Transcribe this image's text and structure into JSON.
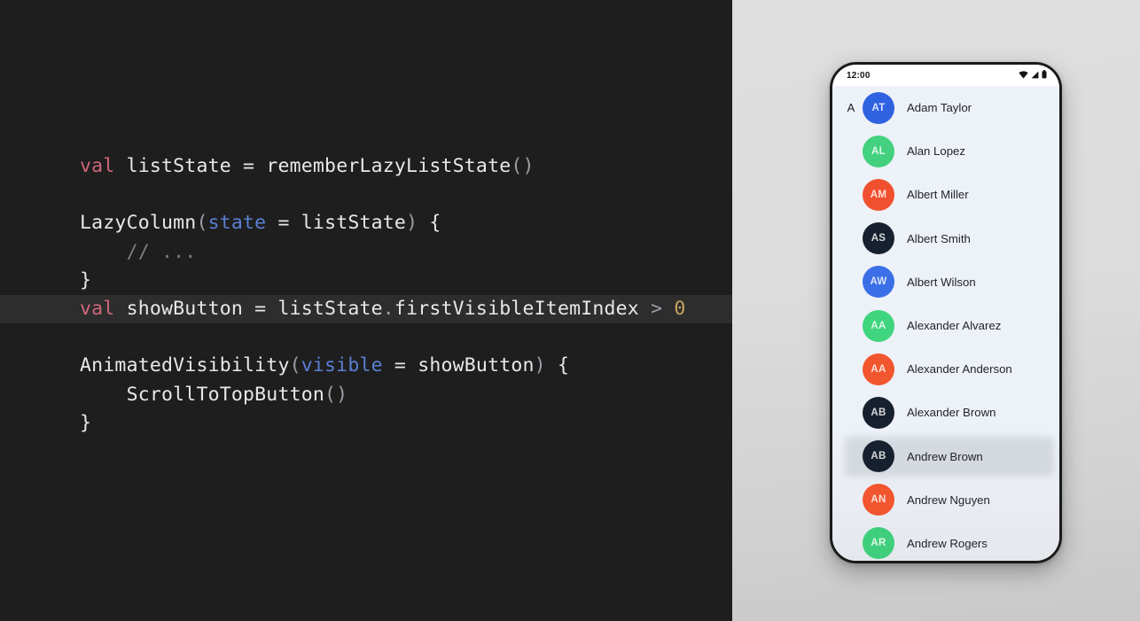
{
  "code": {
    "language": "kotlin",
    "highlighted_line_index": 5,
    "lines": [
      {
        "id": "l0",
        "tokens": [
          {
            "t": "val",
            "c": "kw"
          },
          {
            "t": " listState ",
            "c": "plain"
          },
          {
            "t": "= ",
            "c": "plain"
          },
          {
            "t": "rememberLazyListState",
            "c": "plain"
          },
          {
            "t": "()",
            "c": "punc"
          }
        ]
      },
      {
        "id": "l1",
        "tokens": [
          {
            "t": " ",
            "c": "plain"
          }
        ]
      },
      {
        "id": "l2",
        "tokens": [
          {
            "t": "LazyColumn",
            "c": "plain"
          },
          {
            "t": "(",
            "c": "punc"
          },
          {
            "t": "state",
            "c": "param"
          },
          {
            "t": " = ",
            "c": "plain"
          },
          {
            "t": "listState",
            "c": "plain"
          },
          {
            "t": ")",
            "c": "punc"
          },
          {
            "t": " {",
            "c": "plain"
          }
        ]
      },
      {
        "id": "l3",
        "tokens": [
          {
            "t": "    // ...",
            "c": "cmt"
          }
        ]
      },
      {
        "id": "l4",
        "tokens": [
          {
            "t": "}",
            "c": "plain"
          }
        ]
      },
      {
        "id": "l5",
        "tokens": [
          {
            "t": "val",
            "c": "kw"
          },
          {
            "t": " showButton ",
            "c": "plain"
          },
          {
            "t": "= ",
            "c": "plain"
          },
          {
            "t": "listState",
            "c": "plain"
          },
          {
            "t": ".",
            "c": "punc"
          },
          {
            "t": "firstVisibleItemIndex",
            "c": "plain"
          },
          {
            "t": " ",
            "c": "plain"
          },
          {
            "t": ">",
            "c": "punc"
          },
          {
            "t": " ",
            "c": "plain"
          },
          {
            "t": "0",
            "c": "num"
          }
        ]
      },
      {
        "id": "l6",
        "tokens": [
          {
            "t": " ",
            "c": "plain"
          }
        ]
      },
      {
        "id": "l7",
        "tokens": [
          {
            "t": "AnimatedVisibility",
            "c": "plain"
          },
          {
            "t": "(",
            "c": "punc"
          },
          {
            "t": "visible",
            "c": "param"
          },
          {
            "t": " = ",
            "c": "plain"
          },
          {
            "t": "showButton",
            "c": "plain"
          },
          {
            "t": ")",
            "c": "punc"
          },
          {
            "t": " {",
            "c": "plain"
          }
        ]
      },
      {
        "id": "l8",
        "tokens": [
          {
            "t": "    ScrollToTopButton",
            "c": "plain"
          },
          {
            "t": "()",
            "c": "punc"
          }
        ]
      },
      {
        "id": "l9",
        "tokens": [
          {
            "t": "}",
            "c": "plain"
          }
        ]
      }
    ],
    "colors": {
      "background": "#1e1e1e",
      "highlight_background": "#2d2d2d",
      "keyword": "#cf6679",
      "parameter": "#5b7fd4",
      "number": "#c8a45c",
      "comment": "#7d7d7d",
      "punctuation": "#9aa0a6",
      "text": "#e8e8e8"
    }
  },
  "phone": {
    "background_color": "#dcdcdc",
    "status_bar": {
      "time": "12:00",
      "icons": [
        "wifi-icon",
        "signal-icon",
        "battery-icon"
      ]
    },
    "list": {
      "section_header": "A",
      "contacts": [
        {
          "initials": "AT",
          "name": "Adam Taylor",
          "color": "#2f62e0",
          "section": "A",
          "focused": false
        },
        {
          "initials": "AL",
          "name": "Alan Lopez",
          "color": "#43d17f",
          "section": "",
          "focused": false
        },
        {
          "initials": "AM",
          "name": "Albert Miller",
          "color": "#f1502f",
          "section": "",
          "focused": false
        },
        {
          "initials": "AS",
          "name": "Albert Smith",
          "color": "#16202e",
          "section": "",
          "focused": false
        },
        {
          "initials": "AW",
          "name": "Albert Wilson",
          "color": "#3a6fe8",
          "section": "",
          "focused": false
        },
        {
          "initials": "AA",
          "name": "Alexander Alvarez",
          "color": "#3fd47e",
          "section": "",
          "focused": false
        },
        {
          "initials": "AA",
          "name": "Alexander Anderson",
          "color": "#f2562f",
          "section": "",
          "focused": false
        },
        {
          "initials": "AB",
          "name": "Alexander Brown",
          "color": "#16202e",
          "section": "",
          "focused": false
        },
        {
          "initials": "AB",
          "name": "Andrew Brown",
          "color": "#16202e",
          "section": "",
          "focused": true
        },
        {
          "initials": "AN",
          "name": "Andrew Nguyen",
          "color": "#f2562f",
          "section": "",
          "focused": false
        },
        {
          "initials": "AR",
          "name": "Andrew Rogers",
          "color": "#3fcf7c",
          "section": "",
          "focused": false
        },
        {
          "initials": "",
          "name": "",
          "color": "#f2562f",
          "section": "",
          "focused": false
        }
      ]
    }
  }
}
